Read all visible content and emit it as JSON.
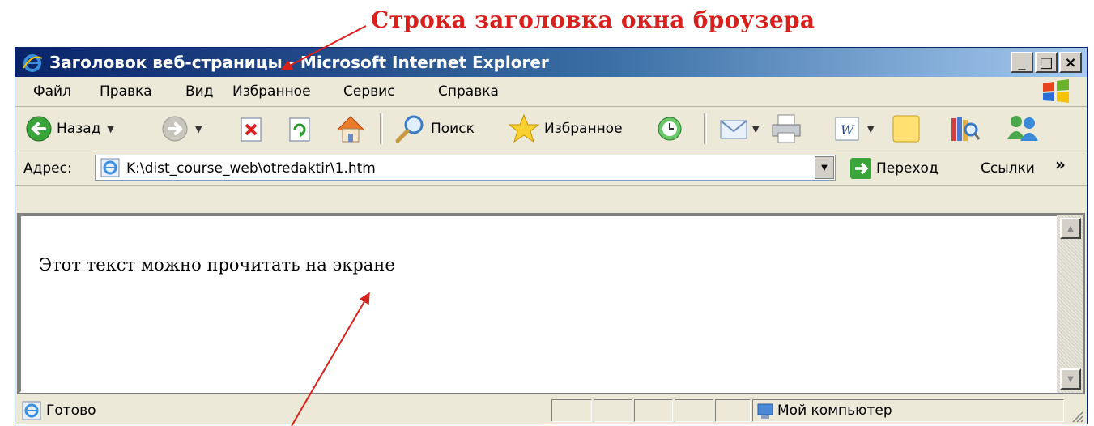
{
  "annotation": {
    "text": "Строка заголовка окна броузера",
    "color": "#d8201c"
  },
  "window": {
    "title": "Заголовок веб-страницы - Microsoft Internet Explorer"
  },
  "window_buttons": {
    "minimize": "_",
    "maximize": "□",
    "close": "×"
  },
  "menu": [
    "Файл",
    "Правка",
    "Вид",
    "Избранное",
    "Сервис",
    "Справка"
  ],
  "toolbar": {
    "back": "Назад",
    "search": "Поиск",
    "favorites": "Избранное"
  },
  "address_bar": {
    "label": "Адрес:",
    "url": "K:\\dist_course_web\\otredaktir\\1.htm",
    "go": "Переход",
    "links": "Ссылки",
    "more": "»"
  },
  "content": {
    "text": "Этот текст можно прочитать на экране"
  },
  "status_bar": {
    "text": "Готово",
    "zone": "Мой компьютер"
  },
  "colors": {
    "titlebar_start": "#0a246a",
    "titlebar_end": "#a6caf0",
    "chrome": "#ece9d8"
  }
}
